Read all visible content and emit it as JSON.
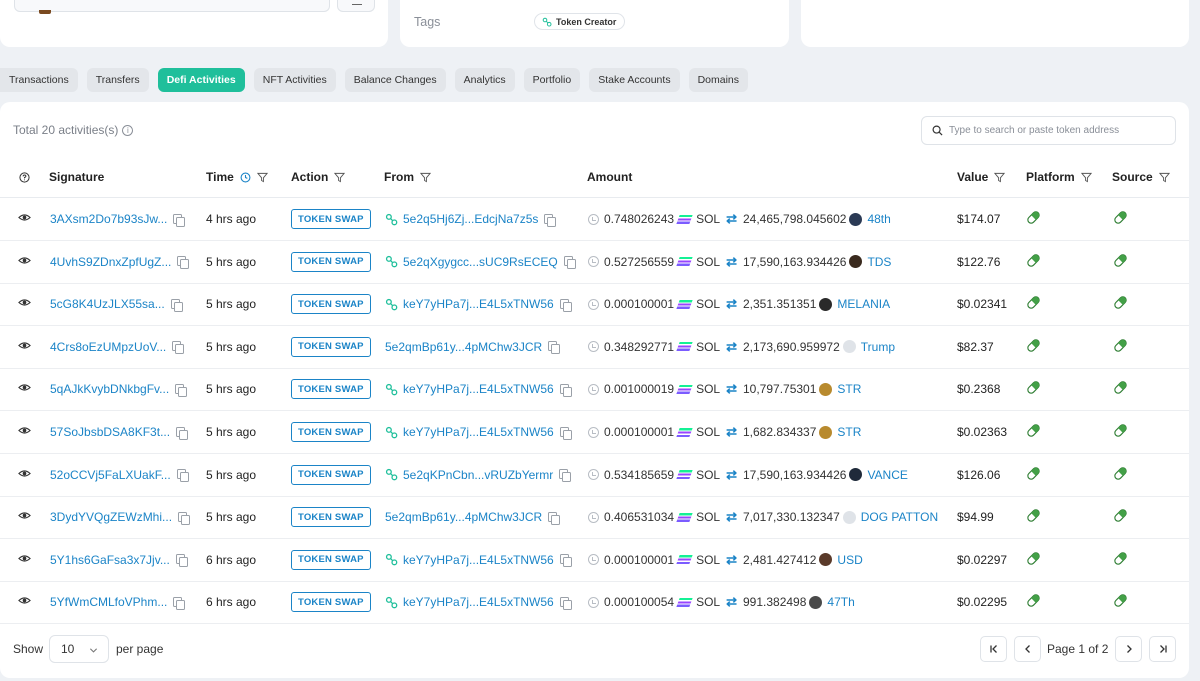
{
  "overview": {
    "tags_label": "Tags",
    "tag": "Token Creator"
  },
  "tabs": [
    {
      "label": "Transactions",
      "active": false
    },
    {
      "label": "Transfers",
      "active": false
    },
    {
      "label": "Defi Activities",
      "active": true
    },
    {
      "label": "NFT Activities",
      "active": false
    },
    {
      "label": "Balance Changes",
      "active": false
    },
    {
      "label": "Analytics",
      "active": false
    },
    {
      "label": "Portfolio",
      "active": false
    },
    {
      "label": "Stake Accounts",
      "active": false
    },
    {
      "label": "Domains",
      "active": false
    }
  ],
  "summary": {
    "total": "Total 20 activities(s)"
  },
  "search": {
    "placeholder": "Type to search or paste token address"
  },
  "columns": {
    "signature": "Signature",
    "time": "Time",
    "action": "Action",
    "from": "From",
    "amount": "Amount",
    "value": "Value",
    "platform": "Platform",
    "source": "Source"
  },
  "rows": [
    {
      "signature": "3AXsm2Do7b93sJw...",
      "time": "4 hrs ago",
      "action": "TOKEN SWAP",
      "from": "5e2q5Hj6Zj...EdcjNa7z5s",
      "from_icon": true,
      "amount_in": "0.748026243",
      "token_in": "SOL",
      "amount_out": "24,465,798.045602",
      "token_out": "48th",
      "token_color": "#2b3a55",
      "value": "$174.07"
    },
    {
      "signature": "4UvhS9ZDnxZpfUgZ...",
      "time": "5 hrs ago",
      "action": "TOKEN SWAP",
      "from": "5e2qXgygcc...sUC9RsECEQ",
      "from_icon": true,
      "amount_in": "0.527256559",
      "token_in": "SOL",
      "amount_out": "17,590,163.934426",
      "token_out": "TDS",
      "token_color": "#3a2a1e",
      "value": "$122.76"
    },
    {
      "signature": "5cG8K4UzJLX55sa...",
      "time": "5 hrs ago",
      "action": "TOKEN SWAP",
      "from": "keY7yHPa7j...E4L5xTNW56",
      "from_icon": true,
      "amount_in": "0.000100001",
      "token_in": "SOL",
      "amount_out": "2,351.351351",
      "token_out": "MELANIA",
      "token_color": "#2a2a2a",
      "value": "$0.02341"
    },
    {
      "signature": "4Crs8oEzUMpzUoV...",
      "time": "5 hrs ago",
      "action": "TOKEN SWAP",
      "from": "5e2qmBp61y...4pMChw3JCR",
      "from_icon": false,
      "amount_in": "0.348292771",
      "token_in": "SOL",
      "amount_out": "2,173,690.959972",
      "token_out": "Trump",
      "token_color": "#dfe3e8",
      "value": "$82.37"
    },
    {
      "signature": "5qAJkKvybDNkbgFv...",
      "time": "5 hrs ago",
      "action": "TOKEN SWAP",
      "from": "keY7yHPa7j...E4L5xTNW56",
      "from_icon": true,
      "amount_in": "0.001000019",
      "token_in": "SOL",
      "amount_out": "10,797.75301",
      "token_out": "STR",
      "token_color": "#b88a2e",
      "value": "$0.2368"
    },
    {
      "signature": "57SoJbsbDSA8KF3t...",
      "time": "5 hrs ago",
      "action": "TOKEN SWAP",
      "from": "keY7yHPa7j...E4L5xTNW56",
      "from_icon": true,
      "amount_in": "0.000100001",
      "token_in": "SOL",
      "amount_out": "1,682.834337",
      "token_out": "STR",
      "token_color": "#b88a2e",
      "value": "$0.02363"
    },
    {
      "signature": "52oCCVj5FaLXUakF...",
      "time": "5 hrs ago",
      "action": "TOKEN SWAP",
      "from": "5e2qKPnCbn...vRUZbYermr",
      "from_icon": true,
      "amount_in": "0.534185659",
      "token_in": "SOL",
      "amount_out": "17,590,163.934426",
      "token_out": "VANCE",
      "token_color": "#1f2a3a",
      "value": "$126.06"
    },
    {
      "signature": "3DydYVQgZEWzMhi...",
      "time": "5 hrs ago",
      "action": "TOKEN SWAP",
      "from": "5e2qmBp61y...4pMChw3JCR",
      "from_icon": false,
      "amount_in": "0.406531034",
      "token_in": "SOL",
      "amount_out": "7,017,330.132347",
      "token_out": "DOG PATTON",
      "token_color": "#dfe3e8",
      "value": "$94.99"
    },
    {
      "signature": "5Y1hs6GaFsa3x7Jjv...",
      "time": "6 hrs ago",
      "action": "TOKEN SWAP",
      "from": "keY7yHPa7j...E4L5xTNW56",
      "from_icon": true,
      "amount_in": "0.000100001",
      "token_in": "SOL",
      "amount_out": "2,481.427412",
      "token_out": "USD",
      "token_color": "#5a3a2a",
      "value": "$0.02297"
    },
    {
      "signature": "5YfWmCMLfoVPhm...",
      "time": "6 hrs ago",
      "action": "TOKEN SWAP",
      "from": "keY7yHPa7j...E4L5xTNW56",
      "from_icon": true,
      "amount_in": "0.000100054",
      "token_in": "SOL",
      "amount_out": "991.382498",
      "token_out": "47Th",
      "token_color": "#4a4a4a",
      "value": "$0.02295"
    }
  ],
  "footer": {
    "show_label": "Show",
    "page_size": "10",
    "per_page_label": "per page",
    "page_text": "Page 1 of 2"
  }
}
